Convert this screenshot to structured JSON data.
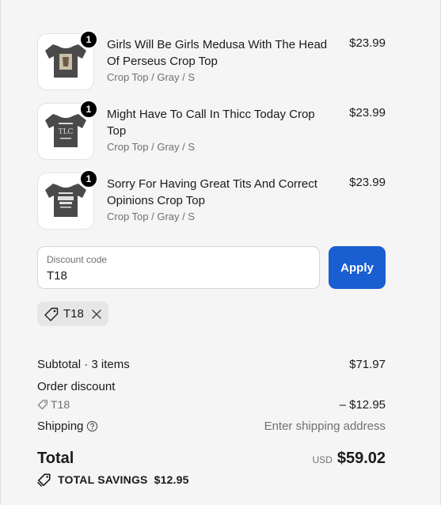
{
  "cart": {
    "items": [
      {
        "name": "Girls Will Be Girls Medusa With The Head Of Perseus Crop Top",
        "variant": "Crop Top / Gray / S",
        "price": "$23.99",
        "quantity": "1"
      },
      {
        "name": "Might Have To Call In Thicc Today Crop Top",
        "variant": "Crop Top / Gray / S",
        "price": "$23.99",
        "quantity": "1"
      },
      {
        "name": "Sorry For Having Great Tits And Correct Opinions Crop Top",
        "variant": "Crop Top / Gray / S",
        "price": "$23.99",
        "quantity": "1"
      }
    ]
  },
  "discount": {
    "label": "Discount code",
    "value": "T18",
    "apply_label": "Apply",
    "applied_code": "T18"
  },
  "summary": {
    "subtotal_label": "Subtotal · 3 items",
    "subtotal_value": "$71.97",
    "order_discount_label": "Order discount",
    "order_discount_code": "T18",
    "order_discount_value": "– $12.95",
    "shipping_label": "Shipping",
    "shipping_value": "Enter shipping address",
    "total_label": "Total",
    "currency": "USD",
    "total_value": "$59.02",
    "savings_label": "TOTAL SAVINGS",
    "savings_value": "$12.95"
  },
  "colors": {
    "accent": "#1a5fd1",
    "shirt": "#4a4a4a"
  },
  "icons": {
    "tag": "tag-icon",
    "remove": "close-icon",
    "help": "question-circle-icon",
    "savings": "tag-icon"
  }
}
